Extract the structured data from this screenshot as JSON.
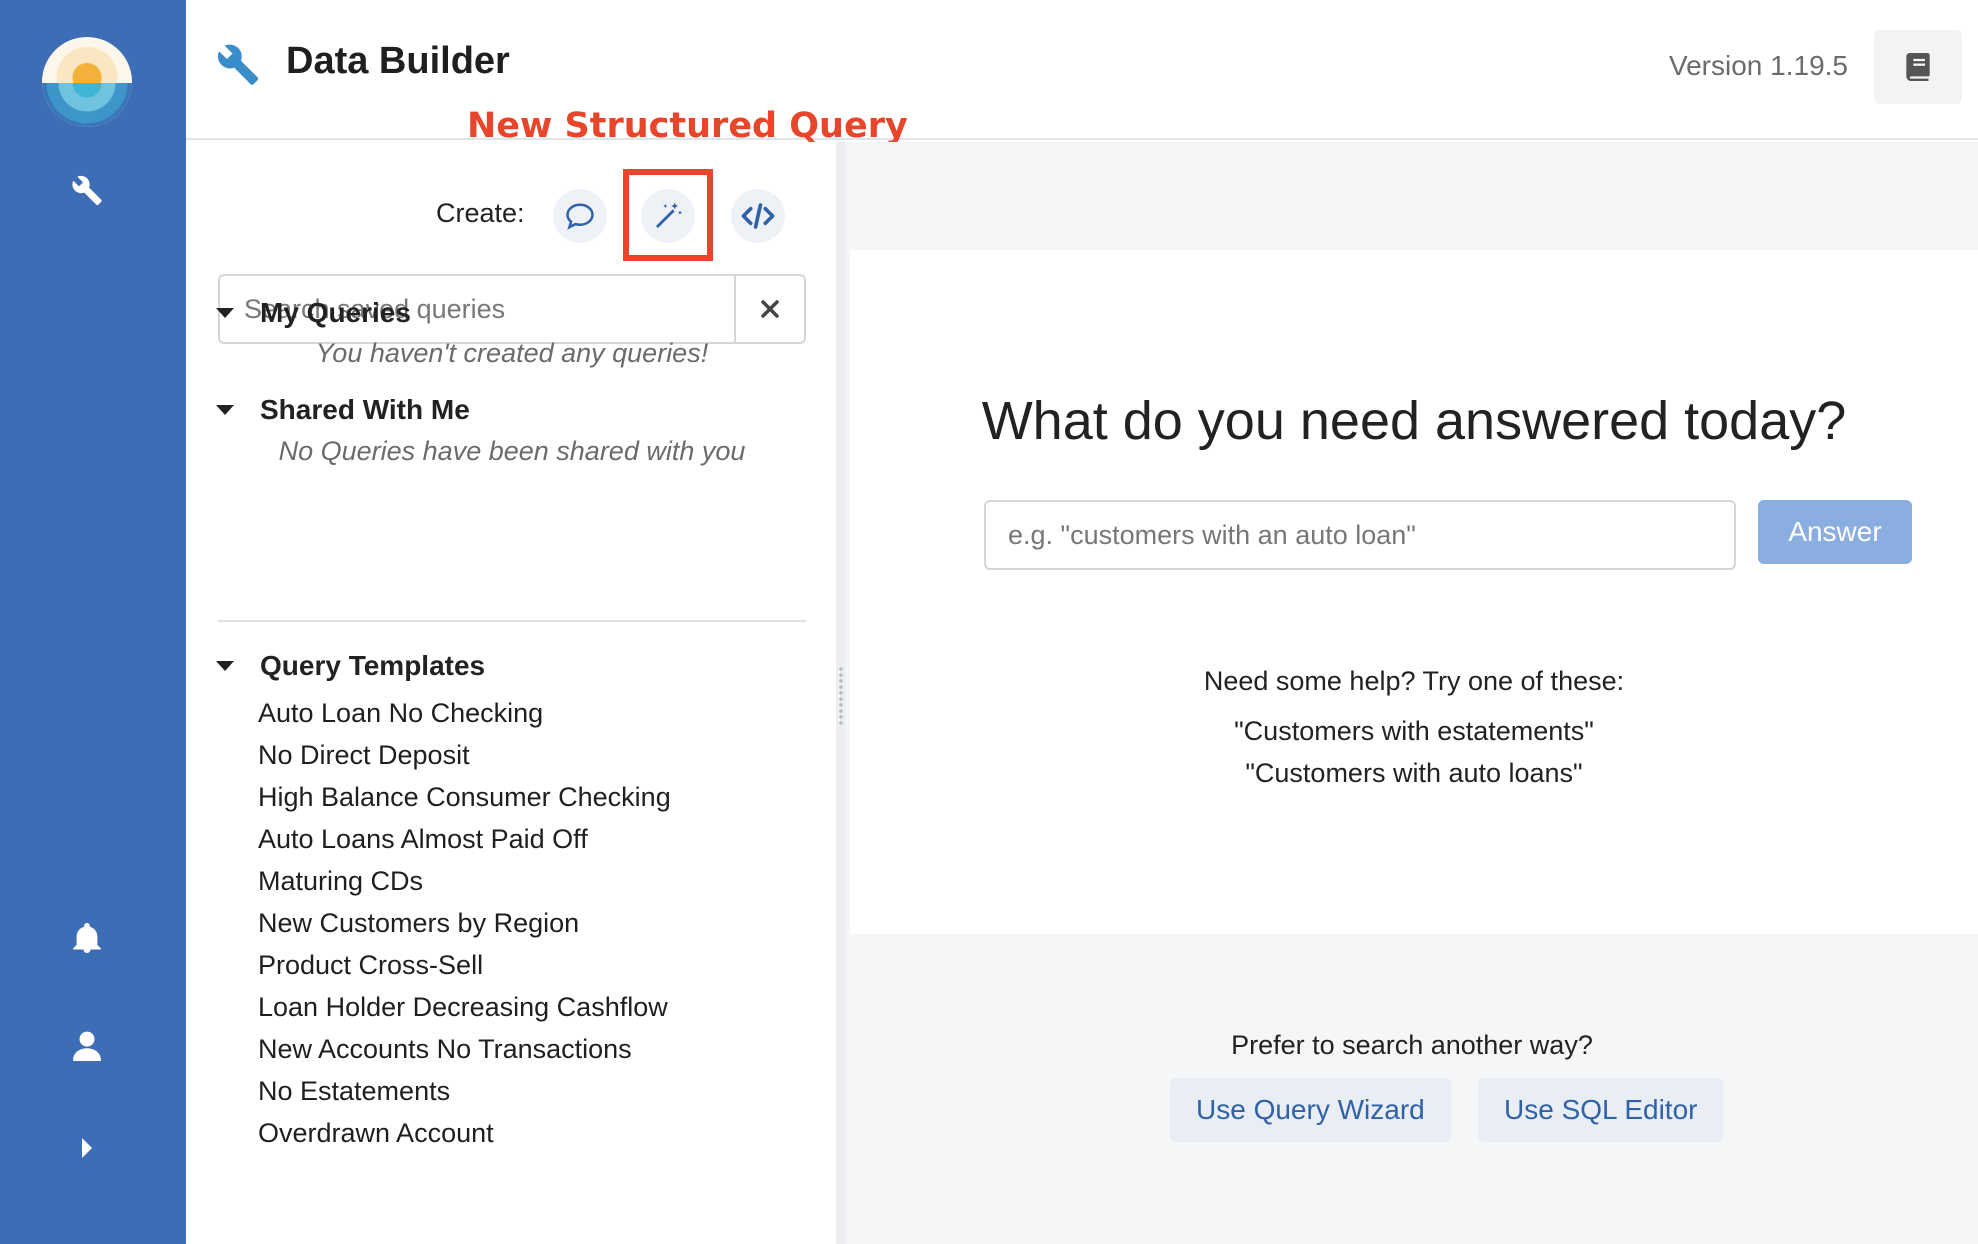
{
  "app": {
    "title": "Data Builder",
    "version": "Version 1.19.5"
  },
  "annotation": {
    "label": "New Structured Query",
    "color": "#e8462b"
  },
  "colors": {
    "rail": "#3d6db5",
    "accent": "#2f62a8",
    "answer_button": "#8aaee0"
  },
  "rail": {
    "icons": [
      "wrench-icon",
      "bell-icon",
      "user-icon",
      "chevron-right-icon"
    ]
  },
  "create": {
    "label": "Create:",
    "buttons": [
      {
        "name": "ask-question-button",
        "icon": "speech-bubble-icon"
      },
      {
        "name": "new-structured-query-button",
        "icon": "magic-wand-icon"
      },
      {
        "name": "new-sql-query-button",
        "icon": "code-icon"
      }
    ]
  },
  "search": {
    "placeholder": "Search saved queries"
  },
  "sections": {
    "my_queries": {
      "title": "My Queries",
      "empty": "You haven't created any queries!"
    },
    "shared": {
      "title": "Shared With Me",
      "empty": "No Queries have been shared with you"
    },
    "templates": {
      "title": "Query Templates",
      "items": [
        "Auto Loan No Checking",
        "No Direct Deposit",
        "High Balance Consumer Checking",
        "Auto Loans Almost Paid Off",
        "Maturing CDs",
        "New Customers by Region",
        "Product Cross-Sell",
        "Loan Holder Decreasing Cashflow",
        "New Accounts No Transactions",
        "No Estatements",
        "Overdrawn Account"
      ]
    }
  },
  "main": {
    "headline": "What do you need answered today?",
    "input_placeholder": "e.g. \"customers with an auto loan\"",
    "answer_label": "Answer",
    "help_title": "Need some help? Try one of these:",
    "help_items": [
      "\"Customers with estatements\"",
      "\"Customers with auto loans\""
    ],
    "alt_title": "Prefer to search another way?",
    "wizard_label": "Use Query Wizard",
    "sql_label": "Use SQL Editor"
  }
}
